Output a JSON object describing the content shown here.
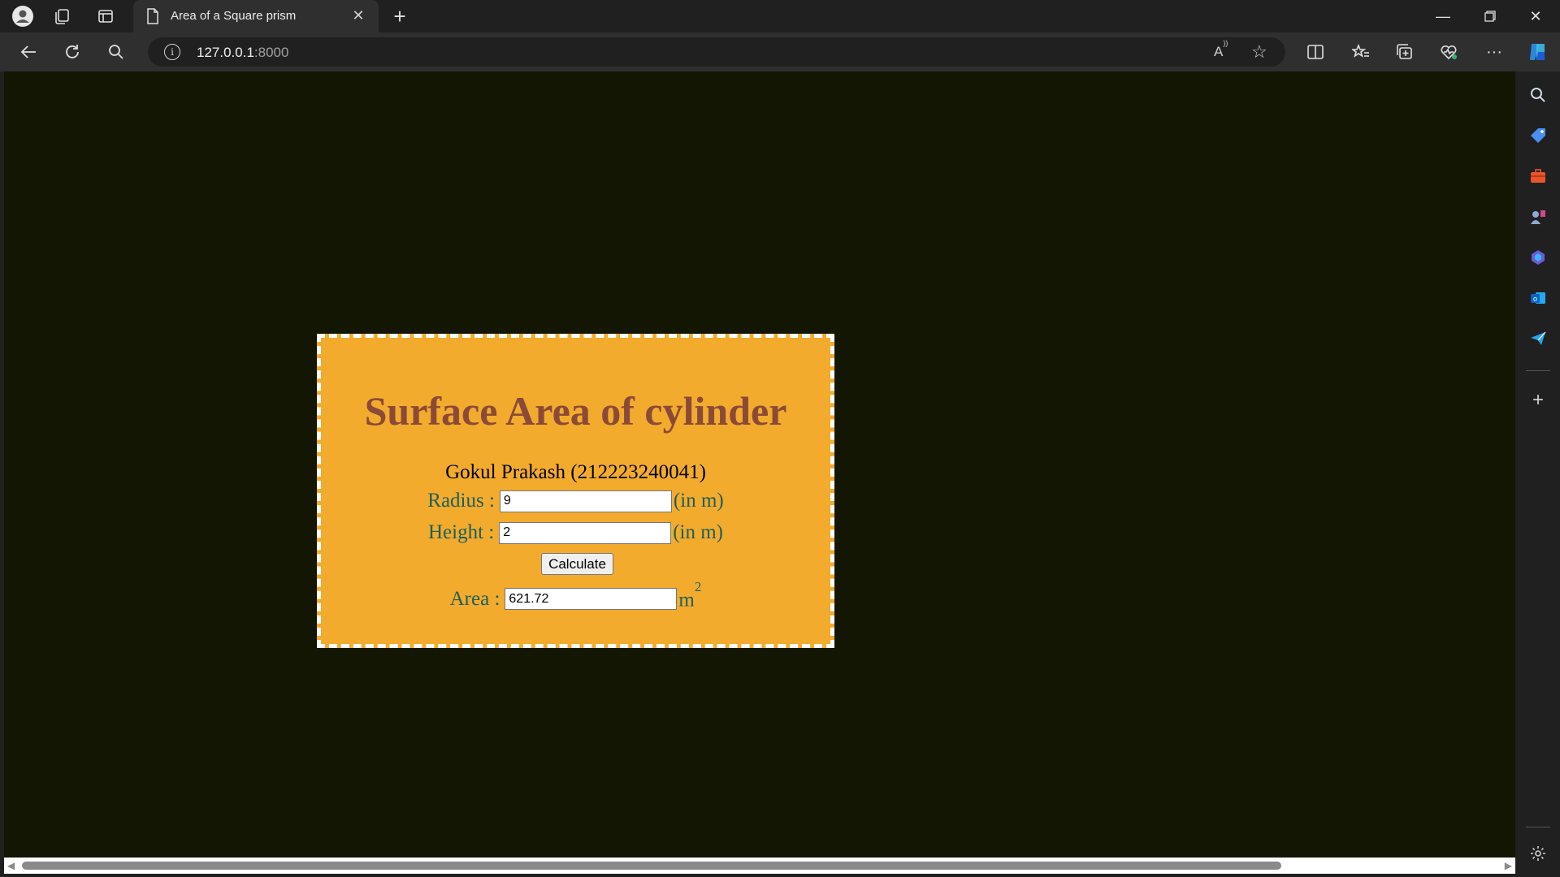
{
  "browser": {
    "tab_title": "Area of a Square prism",
    "address_host": "127.0.0.1",
    "address_port": ":8000"
  },
  "page": {
    "heading": "Surface Area of cylinder",
    "author": "Gokul Prakash (212223240041)",
    "radius_label": "Radius :",
    "radius_value": "9",
    "radius_unit": "(in m)",
    "height_label": "Height :",
    "height_value": "2",
    "height_unit": "(in m)",
    "calculate_label": "Calculate",
    "area_label": "Area :",
    "area_value": "621.72",
    "area_unit": "m",
    "area_unit_exp": "2"
  },
  "colors": {
    "page_background": "#121602",
    "card_background": "#f3ab2e",
    "heading_color": "#8b4a37",
    "label_color": "#1f5f56"
  }
}
